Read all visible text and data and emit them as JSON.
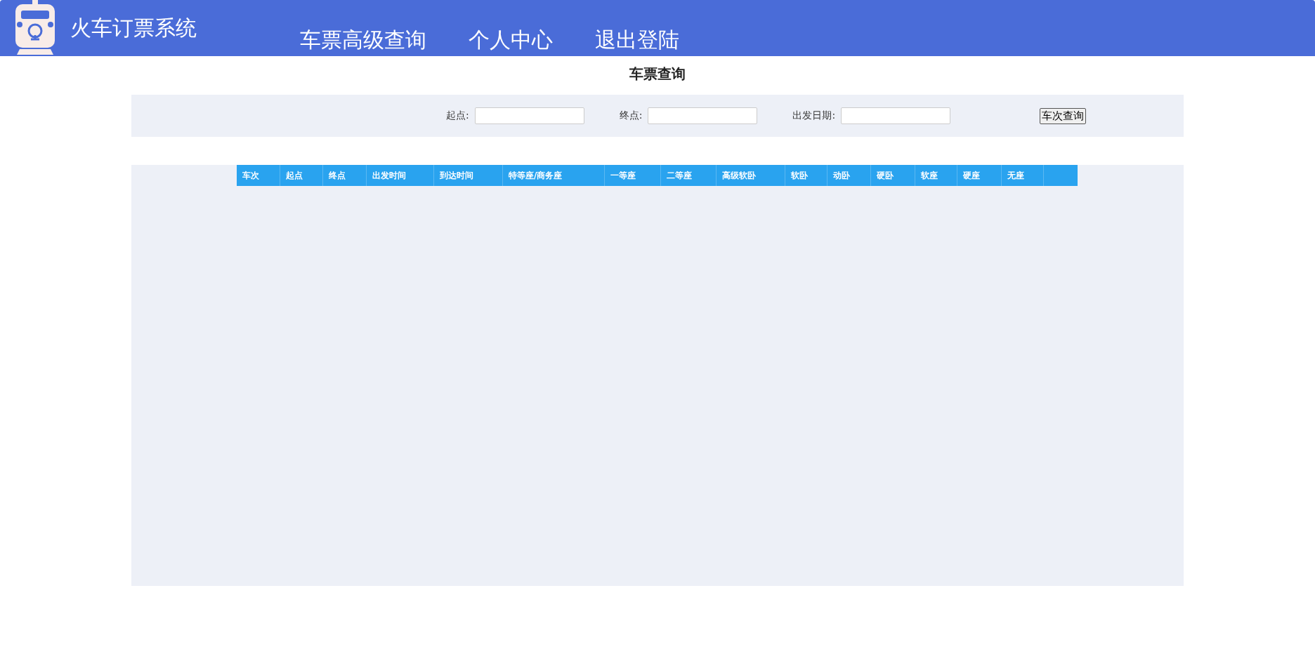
{
  "header": {
    "title": "火车订票系统",
    "nav": [
      {
        "label": "车票高级查询"
      },
      {
        "label": "个人中心"
      },
      {
        "label": "退出登陆"
      }
    ]
  },
  "page_title": "车票查询",
  "search": {
    "fields": [
      {
        "label": "起点:"
      },
      {
        "label": "终点:"
      },
      {
        "label": "出发日期:"
      }
    ],
    "button": "车次查询"
  },
  "table": {
    "columns": [
      "车次",
      "起点",
      "终点",
      "出发时间",
      "到达时间",
      "特等座/商务座",
      "一等座",
      "二等座",
      "高级软卧",
      "软卧",
      "动卧",
      "硬卧",
      "软座",
      "硬座",
      "无座"
    ]
  }
}
